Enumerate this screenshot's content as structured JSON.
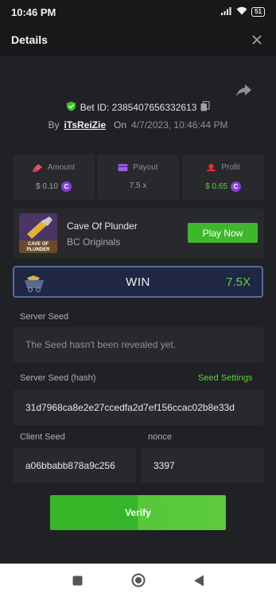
{
  "status_bar": {
    "time": "10:46 PM",
    "battery": "51"
  },
  "header": {
    "title": "Details",
    "close_icon": "close-icon"
  },
  "bet": {
    "id_label": "Bet ID: 2385407656332613",
    "by_label": "By",
    "user": "iTsReiZie",
    "on_label": "On",
    "date": "4/7/2023, 10:46:44 PM"
  },
  "stats": {
    "amount": {
      "label": "Amount",
      "value": "$ 0.10",
      "color": "#e0506a"
    },
    "payout": {
      "label": "Payout",
      "value": "7.5 x",
      "color": "#9b5de5"
    },
    "profit": {
      "label": "Profit",
      "value": "$ 0.65",
      "color": "#e0303a"
    }
  },
  "game": {
    "title": "Cave Of Plunder",
    "provider": "BC Originals",
    "thumb_text": "CAVE OF PLUNDER",
    "play_label": "Play Now"
  },
  "result": {
    "label": "WIN",
    "multiplier": "7.5X"
  },
  "seeds": {
    "server_seed_label": "Server Seed",
    "server_seed_placeholder": "The Seed hasn't been revealed yet.",
    "server_hash_label": "Server Seed (hash)",
    "seed_settings_label": "Seed Settings",
    "server_hash_value": "31d7968ca8e2e27ccedfa2d7ef156ccac02b8e33d",
    "client_seed_label": "Client Seed",
    "client_seed_value": "a06bbabb878a9c256",
    "nonce_label": "nonce",
    "nonce_value": "3397"
  },
  "verify_label": "Verify",
  "colors": {
    "accent_green": "#3fb72c",
    "background": "#1f2124",
    "panel": "#28292c"
  }
}
